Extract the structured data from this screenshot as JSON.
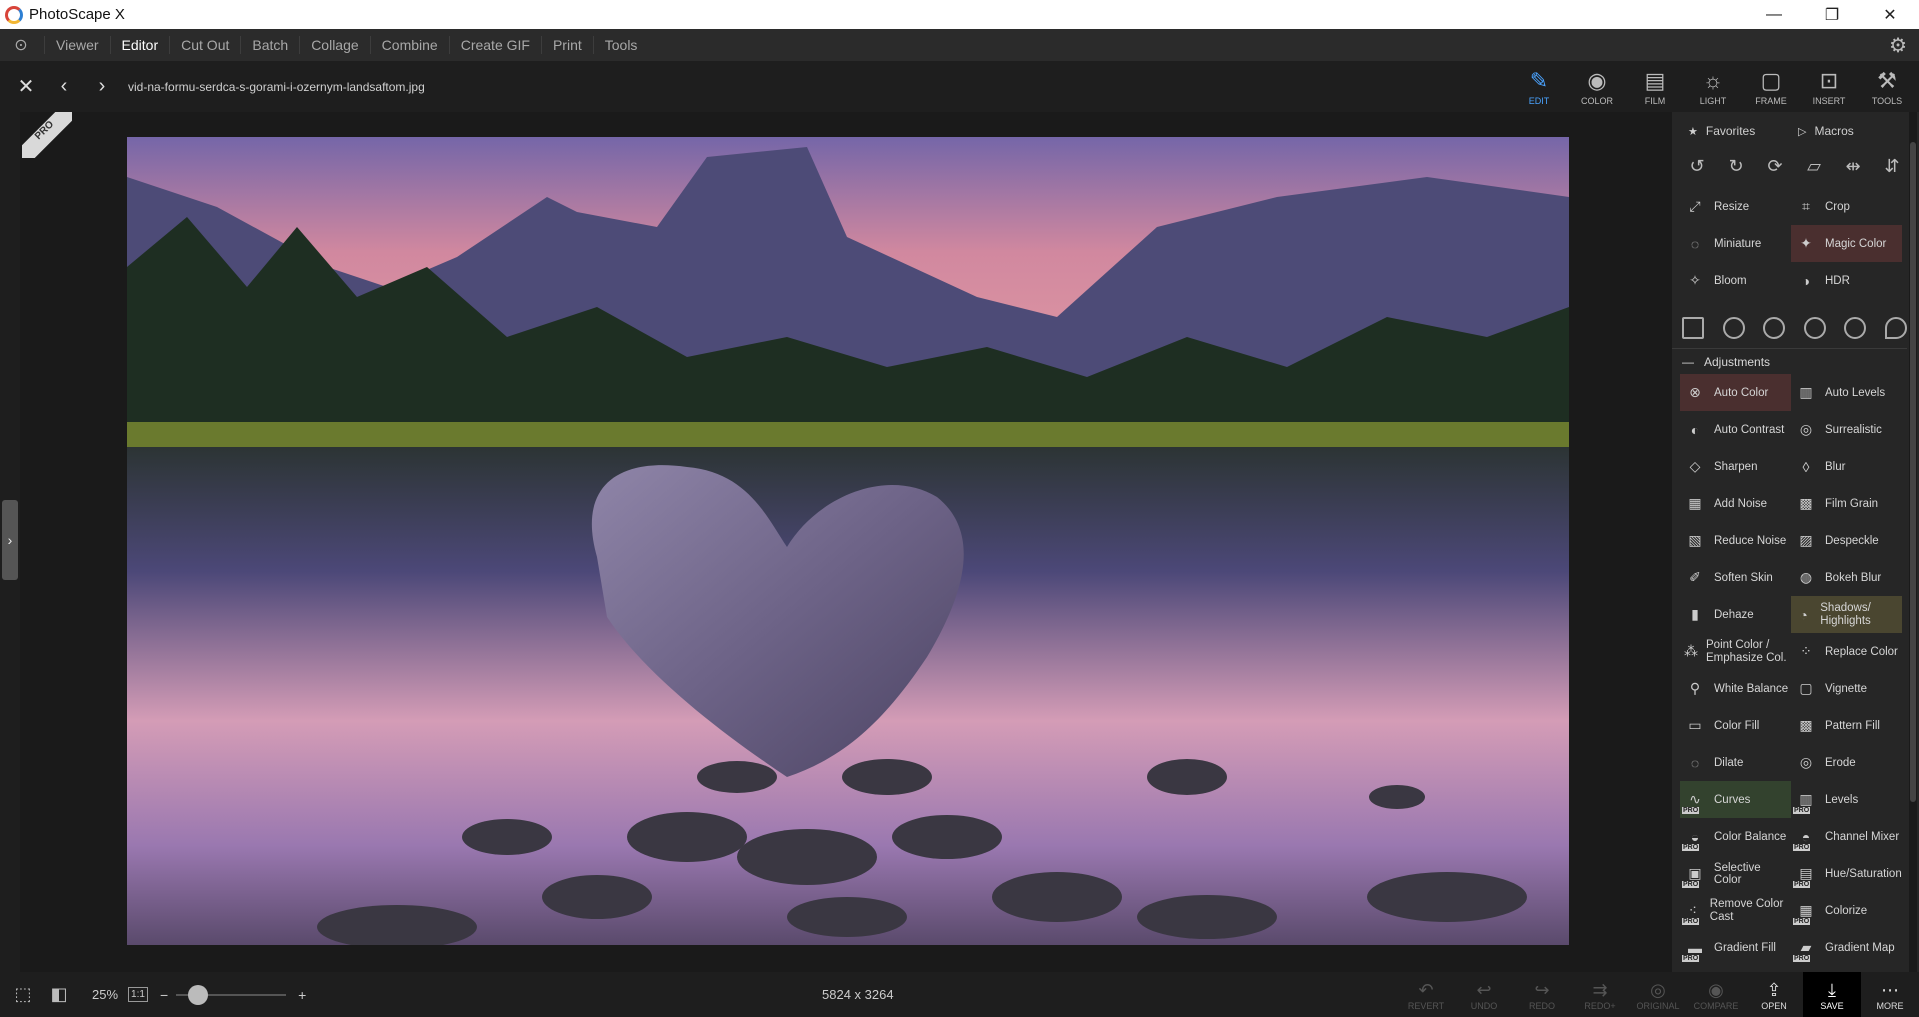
{
  "app": {
    "title": "PhotoScape X"
  },
  "window": {
    "minimize": "—",
    "restore": "❐",
    "close": "✕"
  },
  "menu": [
    "Viewer",
    "Editor",
    "Cut Out",
    "Batch",
    "Collage",
    "Combine",
    "Create GIF",
    "Print",
    "Tools"
  ],
  "file": {
    "name": "vid-na-formu-serdca-s-gorami-i-ozernym-landsaftom.jpg"
  },
  "tool_tabs": [
    {
      "label": "EDIT",
      "icon": "edit-icon"
    },
    {
      "label": "COLOR",
      "icon": "color-icon"
    },
    {
      "label": "FILM",
      "icon": "film-icon"
    },
    {
      "label": "LIGHT",
      "icon": "light-icon"
    },
    {
      "label": "FRAME",
      "icon": "frame-icon"
    },
    {
      "label": "INSERT",
      "icon": "insert-icon"
    },
    {
      "label": "TOOLS",
      "icon": "tools-icon"
    }
  ],
  "panel": {
    "favorites": "Favorites",
    "macros": "Macros",
    "adjustments": "Adjustments",
    "top_tools": [
      "Resize",
      "Crop",
      "Miniature",
      "Magic Color",
      "Bloom",
      "HDR"
    ],
    "adjust_tools": [
      "Auto Color",
      "Auto Levels",
      "Auto Contrast",
      "Surrealistic",
      "Sharpen",
      "Blur",
      "Add Noise",
      "Film Grain",
      "Reduce Noise",
      "Despeckle",
      "Soften Skin",
      "Bokeh Blur",
      "Dehaze",
      "Shadows/ Highlights",
      "Point Color / Emphasize Col.",
      "Replace Color",
      "White Balance",
      "Vignette",
      "Color Fill",
      "Pattern Fill",
      "Dilate",
      "Erode",
      "Curves",
      "Levels",
      "Color Balance",
      "Channel Mixer",
      "Selective Color",
      "Hue/Saturation",
      "Remove Color Cast",
      "Colorize",
      "Gradient Fill",
      "Gradient Map"
    ]
  },
  "status": {
    "zoom": "25%",
    "one_to_one": "1:1",
    "zoom_level": 0.25,
    "dimensions": "5824 x 3264"
  },
  "bottom_buttons": [
    "REVERT",
    "UNDO",
    "REDO",
    "REDO+",
    "ORIGINAL",
    "COMPARE",
    "OPEN",
    "SAVE",
    "MORE"
  ],
  "badge": {
    "pro": "PRO"
  },
  "colors": {
    "accent": "#4aa3ff",
    "bg": "#1e1e1e",
    "panel": "#262626"
  }
}
